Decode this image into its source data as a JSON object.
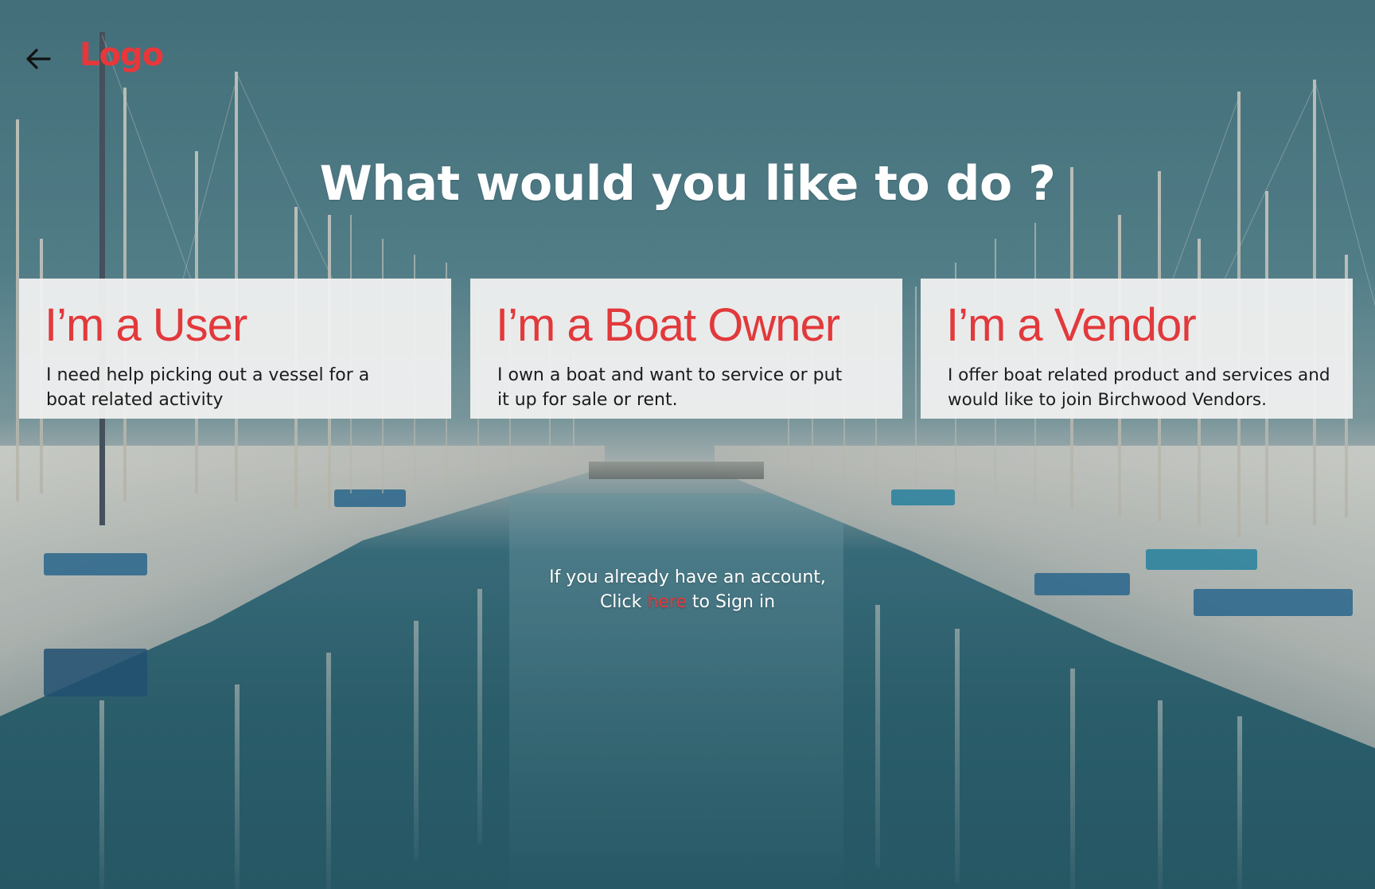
{
  "header": {
    "back_icon": "arrow-left-icon",
    "logo_text": "Logo"
  },
  "title": "What would you like to do ?",
  "cards": [
    {
      "title": "I’m a User",
      "description": "I need help picking out a vessel for a boat related activity"
    },
    {
      "title": "I’m a Boat Owner",
      "description": "I own a boat and want to service or put it up for sale or rent."
    },
    {
      "title": "I’m a Vendor",
      "description": "I offer boat related product and services and would like to join Birchwood Vendors."
    }
  ],
  "signin": {
    "line1": "If you already have an account,",
    "prefix": "Click ",
    "link": "here",
    "suffix": " to Sign in"
  },
  "colors": {
    "accent": "#e8373a",
    "card_bg": "#f0f0f0",
    "title": "#ffffff"
  }
}
